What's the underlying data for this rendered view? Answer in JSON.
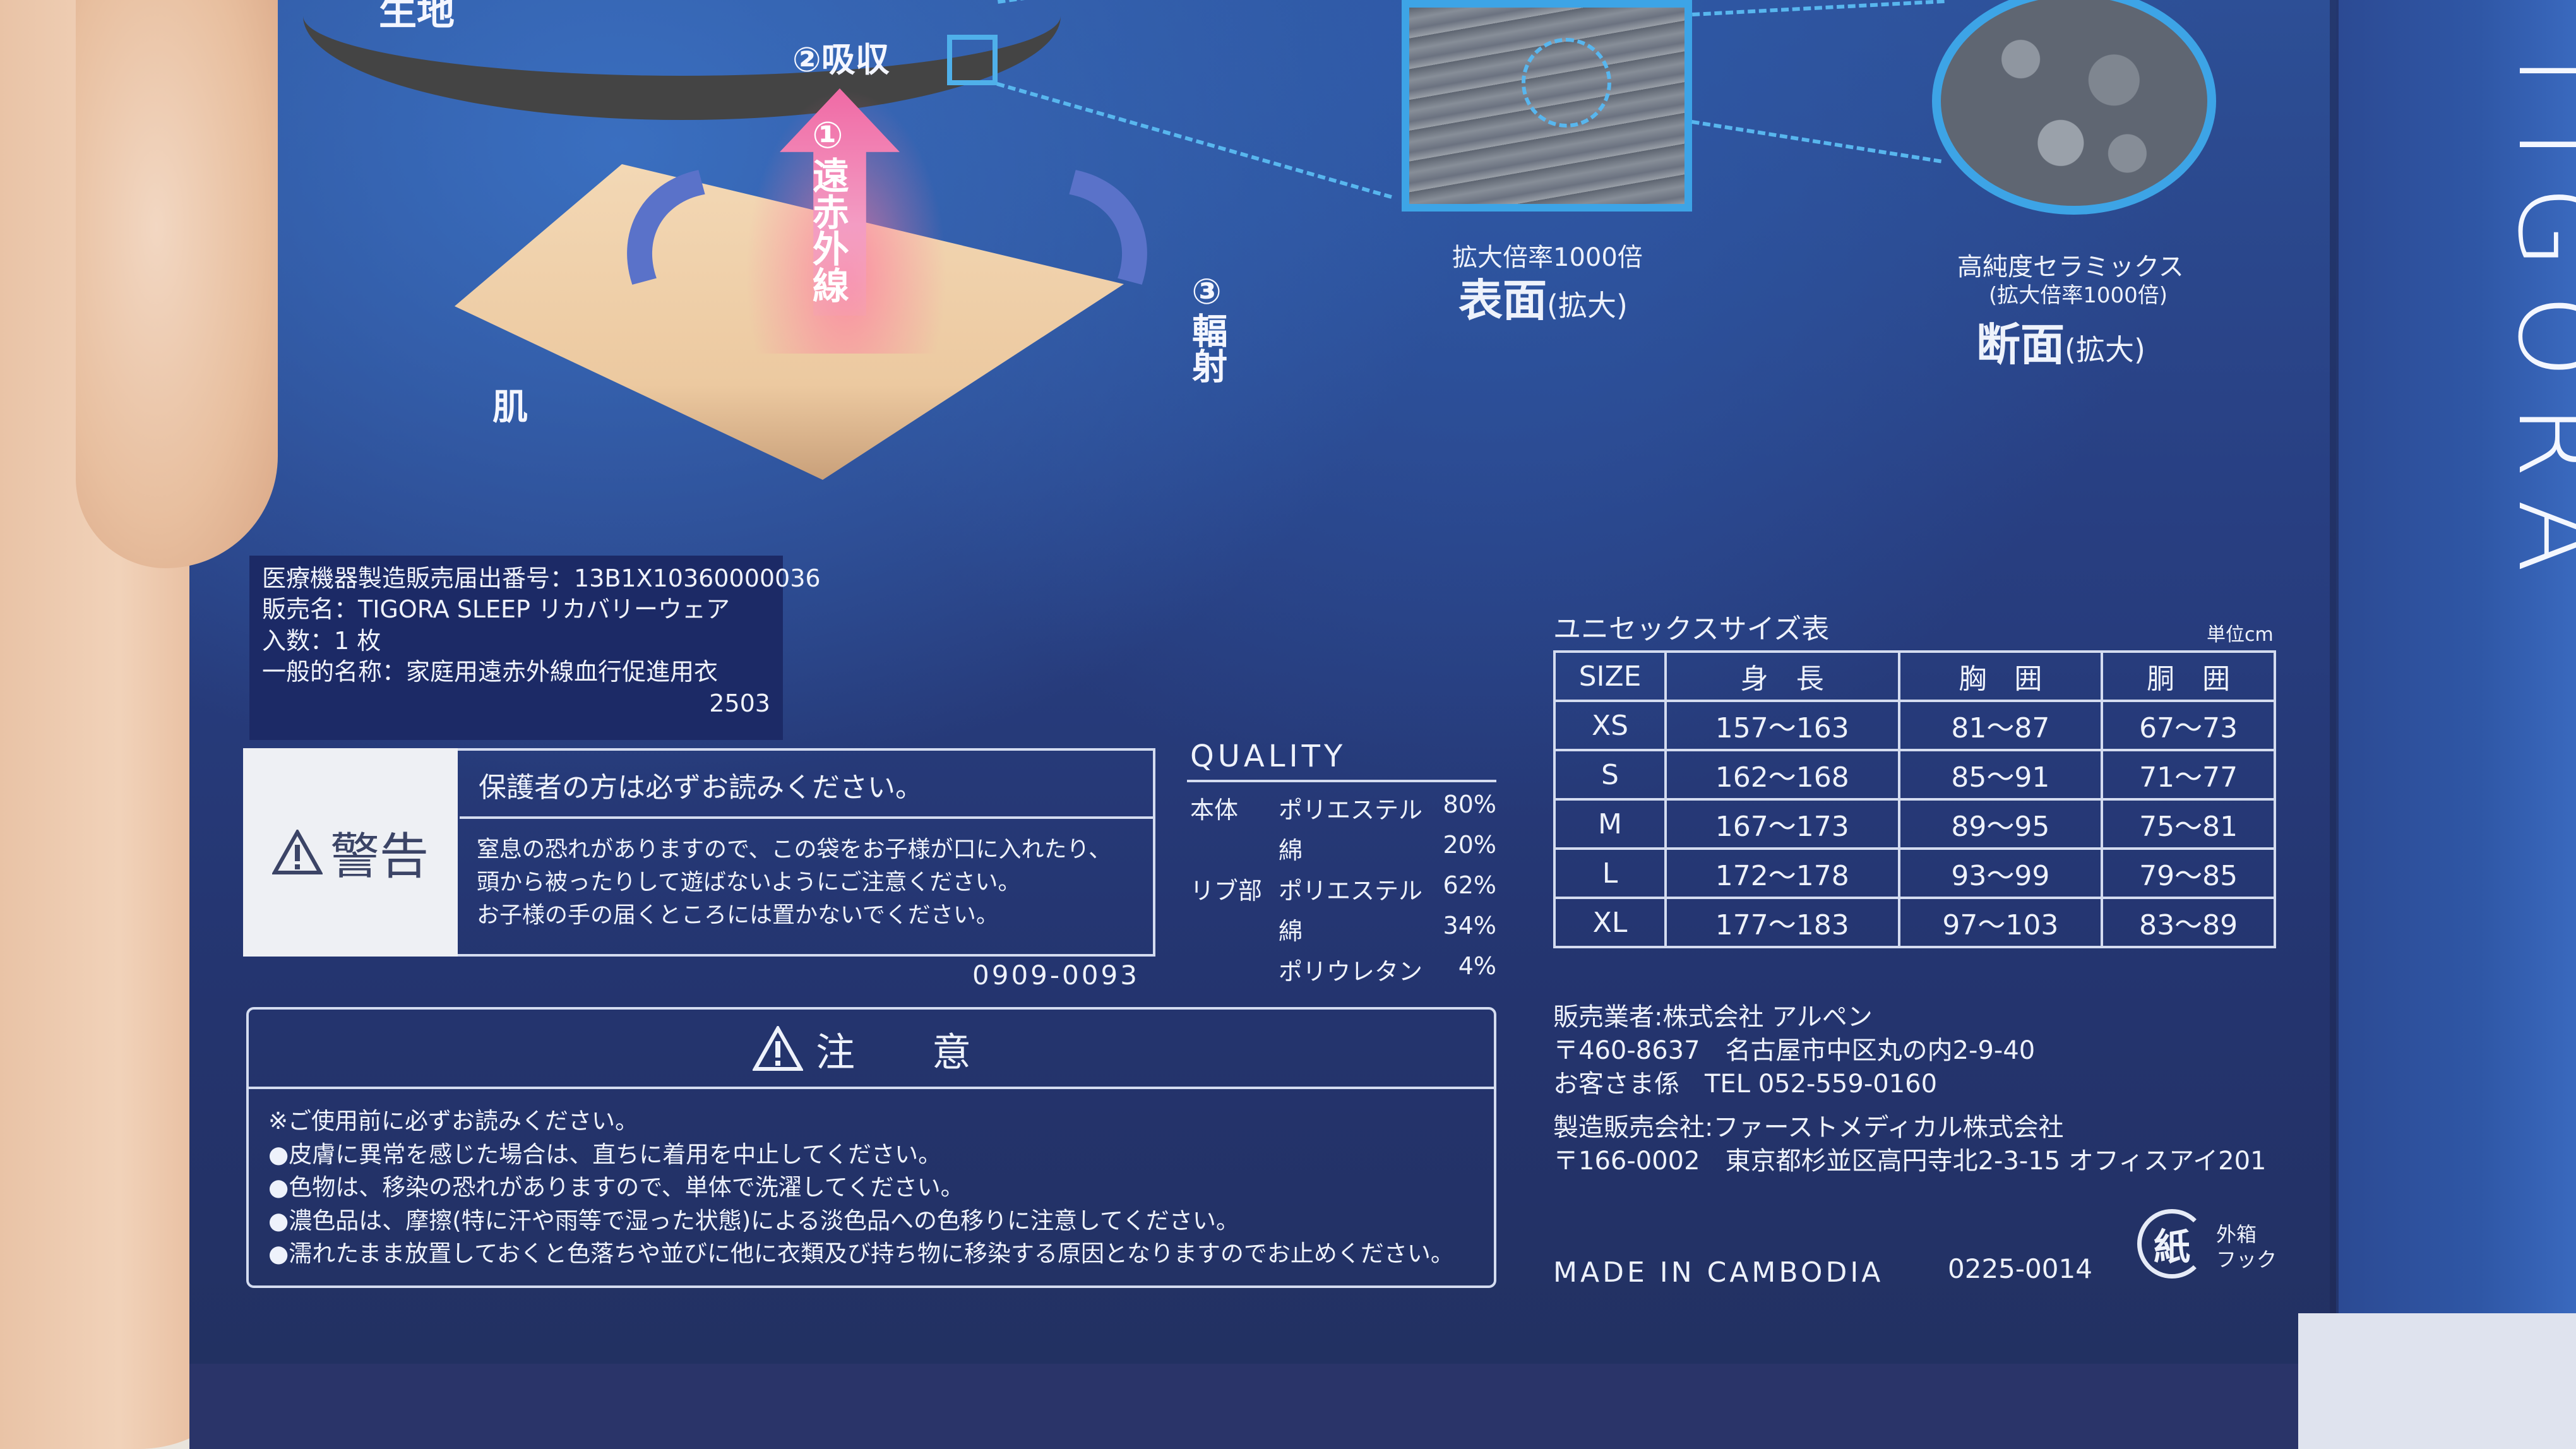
{
  "diagram": {
    "fabric_label": "生地",
    "absorb_label": "②吸収",
    "far_infrared_label": "①遠赤外線",
    "radiation_label": "③輻射",
    "skin_label": "肌"
  },
  "magnified": {
    "surface_small": "拡大倍率1000倍",
    "surface_title": "表面",
    "surface_suffix": "(拡大)",
    "ceramic_small1": "高純度セラミックス",
    "ceramic_small2": "(拡大倍率1000倍)",
    "ceramic_title": "断面",
    "ceramic_suffix": "(拡大)"
  },
  "brand": "TIGORA",
  "medical": {
    "lines": [
      "医療機器製造販売届出番号：13B1X10360000036",
      "販売名：TIGORA SLEEP リカバリーウェア",
      "入数：1 枚",
      "一般的名称：家庭用遠赤外線血行促進用衣"
    ],
    "code": "2503"
  },
  "warning": {
    "label": "警告",
    "heading": "保護者の方は必ずお読みください。",
    "body": [
      "窒息の恐れがありますので、この袋をお子様が口に入れたり、",
      "頭から被ったりして遊ばないようにご注意ください。",
      "お子様の手の届くところには置かないでください。"
    ],
    "code": "0909-0093"
  },
  "quality": {
    "title": "QUALITY",
    "rows": [
      {
        "part": "本体",
        "material": "ポリエステル",
        "percent": "80%"
      },
      {
        "part": "",
        "material": "綿",
        "percent": "20%"
      },
      {
        "part": "リブ部",
        "material": "ポリエステル",
        "percent": "62%"
      },
      {
        "part": "",
        "material": "綿",
        "percent": "34%"
      },
      {
        "part": "",
        "material": "ポリウレタン",
        "percent": "4%"
      }
    ]
  },
  "caution": {
    "title": "注　意",
    "lines": [
      "※ご使用前に必ずお読みください。",
      "●皮膚に異常を感じた場合は、直ちに着用を中止してください。",
      "●色物は、移染の恐れがありますので、単体で洗濯してください。",
      "●濃色品は、摩擦(特に汗や雨等で湿った状態)による淡色品への色移りに注意してください。",
      "●濡れたまま放置しておくと色落ちや並びに他に衣類及び持ち物に移染する原因となりますのでお止めください。"
    ]
  },
  "size_table": {
    "title": "ユニセックスサイズ表",
    "unit": "単位cm",
    "headers": [
      "SIZE",
      "身　長",
      "胸　囲",
      "胴　囲"
    ],
    "rows": [
      [
        "XS",
        "157〜163",
        "81〜87",
        "67〜73"
      ],
      [
        "S",
        "162〜168",
        "85〜91",
        "71〜77"
      ],
      [
        "M",
        "167〜173",
        "89〜95",
        "75〜81"
      ],
      [
        "L",
        "172〜178",
        "93〜99",
        "79〜85"
      ],
      [
        "XL",
        "177〜183",
        "97〜103",
        "83〜89"
      ]
    ]
  },
  "seller": {
    "lines": [
      "販売業者:株式会社 アルペン",
      "〒460-8637　名古屋市中区丸の内2-9-40",
      "お客さま係　TEL 052-559-0160"
    ]
  },
  "maker": {
    "lines": [
      "製造販売会社:ファーストメディカル株式会社",
      "〒166-0002　東京都杉並区高円寺北2-3-15 オフィスアイ201"
    ]
  },
  "footer": {
    "made_in": "MADE IN CAMBODIA",
    "code": "0225-0014",
    "recycle_mark": "紙",
    "recycle_label": [
      "外箱",
      "フック"
    ]
  }
}
